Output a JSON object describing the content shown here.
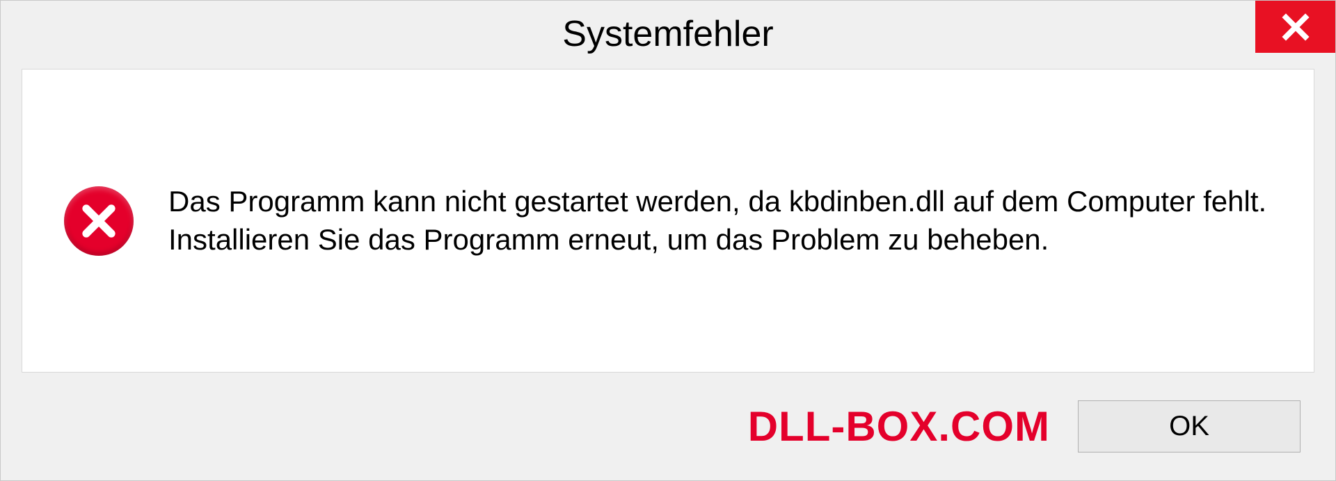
{
  "dialog": {
    "title": "Systemfehler",
    "message": "Das Programm kann nicht gestartet werden, da kbdinben.dll auf dem Computer fehlt. Installieren Sie das Programm erneut, um das Problem zu beheben.",
    "ok_label": "OK",
    "watermark": "DLL-BOX.COM"
  }
}
